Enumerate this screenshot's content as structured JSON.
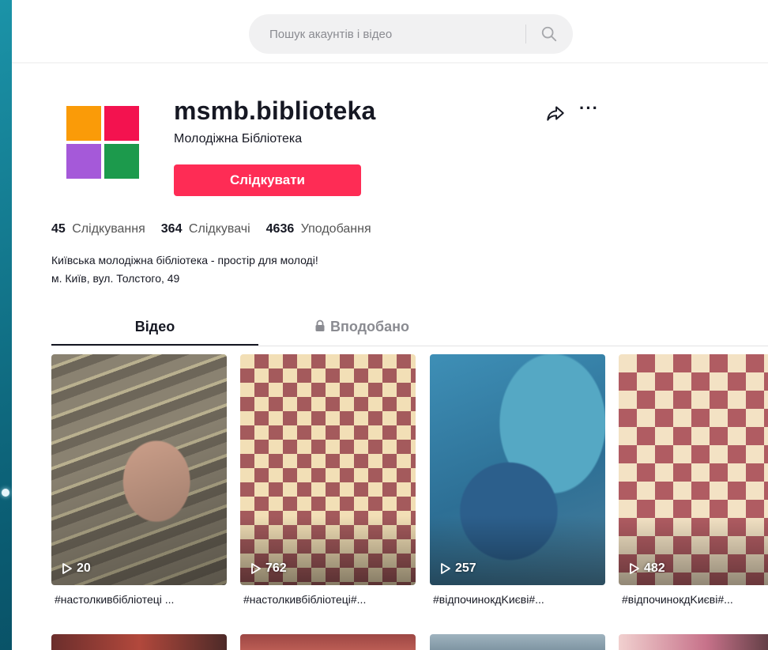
{
  "search": {
    "placeholder": "Пошук акаунтів і відео"
  },
  "profile": {
    "username": "msmb.biblioteka",
    "nickname": "Молодіжна Бібліотека",
    "follow_label": "Слідкувати",
    "avatar_colors": [
      "#fa9b08",
      "#f3124f",
      "#a559d9",
      "#1c9a4c"
    ]
  },
  "stats": {
    "following_count": "45",
    "following_label": "Слідкування",
    "followers_count": "364",
    "followers_label": "Слідкувачі",
    "likes_count": "4636",
    "likes_label": "Уподобання"
  },
  "bio": {
    "line1": "Київська молодіжна бібліотека - простір для молоді!",
    "line2": "м. Київ, вул. Толстого, 49"
  },
  "tabs": {
    "videos": "Відео",
    "liked": "Вподобано"
  },
  "videos": [
    {
      "views": "20",
      "caption": "#настолкивбібліотеці ..."
    },
    {
      "views": "762",
      "caption": "#настолкивбібліотеці#..."
    },
    {
      "views": "257",
      "caption": "#відпочинокдKиєві#..."
    },
    {
      "views": "482",
      "caption": "#відпочинокдKиєві#..."
    }
  ],
  "colors": {
    "accent": "#fe2c55",
    "text": "#161823",
    "muted": "#8a8b91"
  }
}
